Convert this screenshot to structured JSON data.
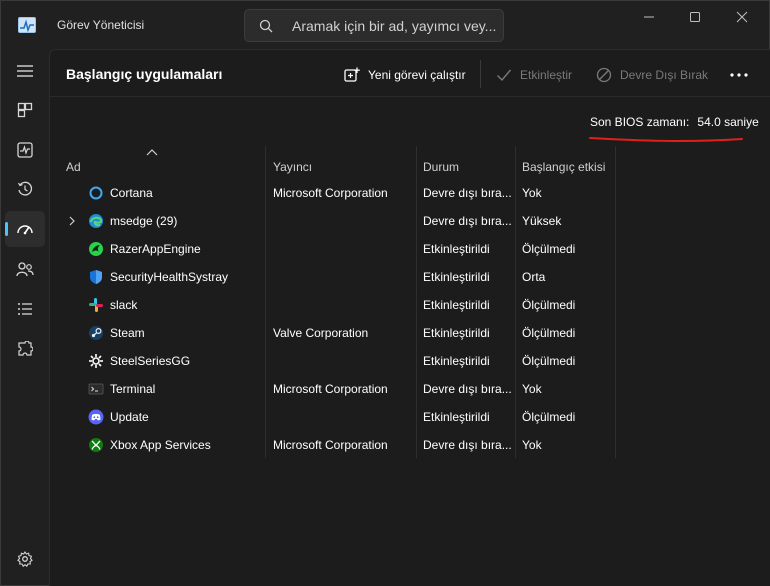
{
  "app": {
    "title": "Görev Yöneticisi"
  },
  "search": {
    "placeholder": "Aramak için bir ad, yayımcı vey..."
  },
  "nav": {
    "items": [
      {
        "name": "menu-icon"
      },
      {
        "name": "processes-icon"
      },
      {
        "name": "performance-icon"
      },
      {
        "name": "app-history-icon"
      },
      {
        "name": "startup-apps-icon",
        "active": true
      },
      {
        "name": "users-icon"
      },
      {
        "name": "details-icon"
      },
      {
        "name": "services-icon"
      },
      {
        "name": "settings-icon"
      }
    ]
  },
  "page": {
    "title": "Başlangıç uygulamaları"
  },
  "toolbar": {
    "new_task": "Yeni görevi çalıştır",
    "enable": "Etkinleştir",
    "disable": "Devre Dışı Bırak",
    "more": "..."
  },
  "bios": {
    "label": "Son BIOS zamanı:",
    "value": "54.0 saniye"
  },
  "table": {
    "columns": [
      "Ad",
      "Yayıncı",
      "Durum",
      "Başlangıç etkisi"
    ],
    "rows": [
      {
        "name": "Cortana",
        "publisher": "Microsoft Corporation",
        "status": "Devre dışı bıra...",
        "impact": "Yok",
        "icon": "cortana-icon"
      },
      {
        "name": "msedge (29)",
        "publisher": "",
        "status": "Devre dışı bıra...",
        "impact": "Yüksek",
        "icon": "edge-icon",
        "expandable": true
      },
      {
        "name": "RazerAppEngine",
        "publisher": "",
        "status": "Etkinleştirildi",
        "impact": "Ölçülmedi",
        "icon": "razer-icon"
      },
      {
        "name": "SecurityHealthSystray",
        "publisher": "",
        "status": "Etkinleştirildi",
        "impact": "Orta",
        "icon": "shield-icon"
      },
      {
        "name": "slack",
        "publisher": "",
        "status": "Etkinleştirildi",
        "impact": "Ölçülmedi",
        "icon": "slack-icon"
      },
      {
        "name": "Steam",
        "publisher": "Valve Corporation",
        "status": "Etkinleştirildi",
        "impact": "Ölçülmedi",
        "icon": "steam-icon"
      },
      {
        "name": "SteelSeriesGG",
        "publisher": "",
        "status": "Etkinleştirildi",
        "impact": "Ölçülmedi",
        "icon": "steelseries-icon"
      },
      {
        "name": "Terminal",
        "publisher": "Microsoft Corporation",
        "status": "Devre dışı bıra...",
        "impact": "Yok",
        "icon": "terminal-icon"
      },
      {
        "name": "Update",
        "publisher": "",
        "status": "Etkinleştirildi",
        "impact": "Ölçülmedi",
        "icon": "discord-icon"
      },
      {
        "name": "Xbox App Services",
        "publisher": "Microsoft Corporation",
        "status": "Devre dışı bıra...",
        "impact": "Yok",
        "icon": "xbox-icon"
      }
    ]
  },
  "colors": {
    "accent": "#4cc2ff",
    "annotation": "#e0201b"
  }
}
